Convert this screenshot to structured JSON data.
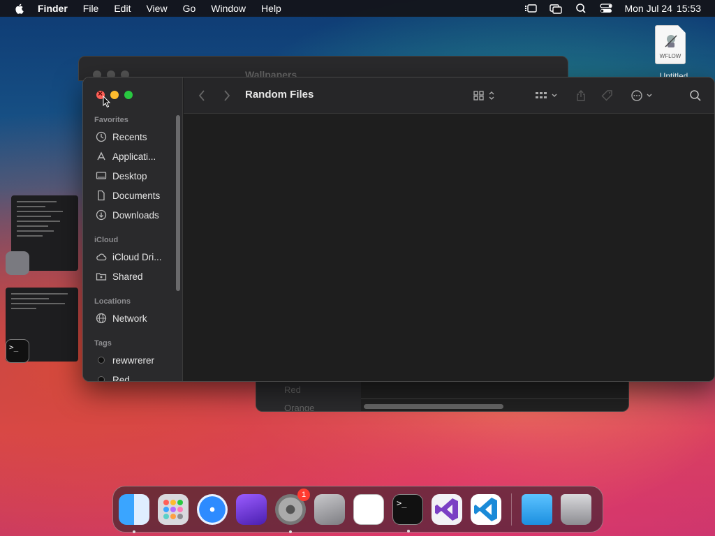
{
  "menubar": {
    "app_name": "Finder",
    "items": [
      "File",
      "Edit",
      "View",
      "Go",
      "Window",
      "Help"
    ],
    "date": "Mon Jul 24",
    "time": "15:53"
  },
  "desktop_file": {
    "label": "WFLOW",
    "caption": "Untitled"
  },
  "back_window": {
    "title": "Wallpapers",
    "tags": [
      "Red",
      "Orange"
    ]
  },
  "finder": {
    "title": "Random Files",
    "sections": {
      "favorites": "Favorites",
      "icloud": "iCloud",
      "locations": "Locations",
      "tags": "Tags"
    },
    "favorites": [
      "Recents",
      "Applicati...",
      "Desktop",
      "Documents",
      "Downloads"
    ],
    "icloud_items": [
      "iCloud Dri...",
      "Shared"
    ],
    "locations": [
      "Network"
    ],
    "tags": [
      "rewwrerer",
      "Red"
    ]
  },
  "dock": {
    "apps": [
      "Finder",
      "Launchpad",
      "Safari",
      "Shortcuts",
      "System Preferences",
      "Automator",
      "TextEdit",
      "Terminal",
      "Visual Studio",
      "Visual Studio Code"
    ],
    "others": [
      "Folder",
      "Trash"
    ],
    "badge_count": "1",
    "terminal_prompt": ">_"
  },
  "colors": {
    "close": "#ff5f57",
    "minimize": "#febc2e",
    "maximize": "#28c840"
  }
}
